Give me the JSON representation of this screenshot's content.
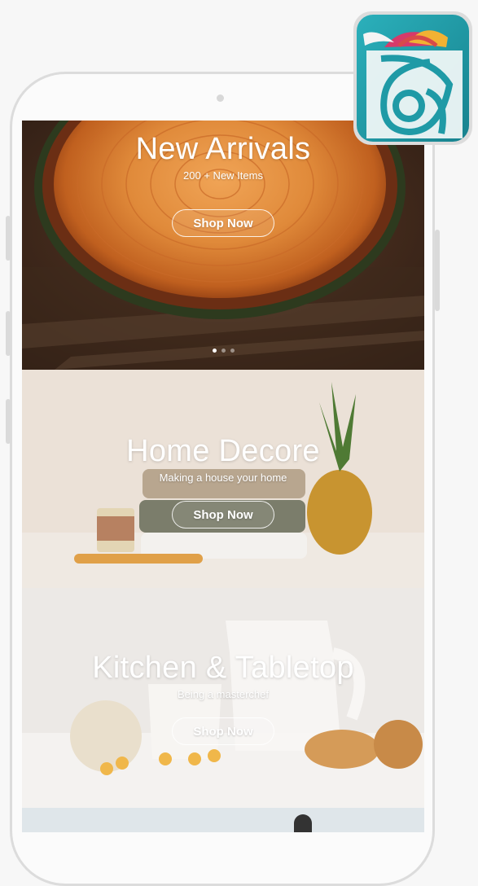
{
  "carousel": {
    "slide_count": 3,
    "active_slide": 0
  },
  "banners": [
    {
      "title": "New Arrivals",
      "subtitle": "200 + New Items",
      "button": "Shop Now"
    },
    {
      "title": "Home Decore",
      "subtitle": "Making a house your home",
      "button": "Shop Now"
    },
    {
      "title": "Kitchen & Tabletop",
      "subtitle": "Being a masterchef",
      "button": "Shop Now"
    }
  ],
  "colors": {
    "teal": "#1f9aa6",
    "wood_orange": "#d9772e",
    "bark_dark": "#3b2618"
  }
}
